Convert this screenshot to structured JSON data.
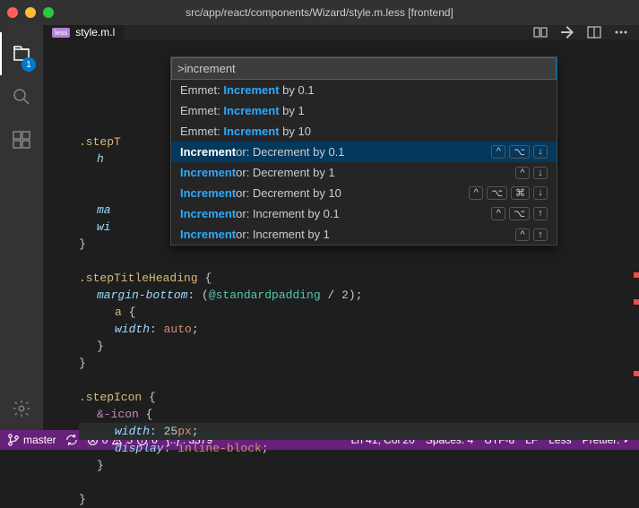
{
  "window": {
    "title": "src/app/react/components/Wizard/style.m.less [frontend]"
  },
  "tab": {
    "lang": "less",
    "name": "style.m.l"
  },
  "explorer_badge": "1",
  "command_palette": {
    "query": ">increment",
    "items": [
      {
        "prefix": "Emmet: ",
        "bold": "Increment",
        "suffix": " by 0.1",
        "keys": []
      },
      {
        "prefix": "Emmet: ",
        "bold": "Increment",
        "suffix": " by 1",
        "keys": []
      },
      {
        "prefix": "Emmet: ",
        "bold": "Increment",
        "suffix": " by 10",
        "keys": []
      },
      {
        "prefix": "",
        "bold": "Increment",
        "suffix": "or: Decrement by 0.1",
        "keys": [
          "^",
          "⌥",
          "↓"
        ],
        "selected": true
      },
      {
        "prefix": "",
        "bold": "Increment",
        "suffix": "or: Decrement by 1",
        "keys": [
          "^",
          "↓"
        ]
      },
      {
        "prefix": "",
        "bold": "Increment",
        "suffix": "or: Decrement by 10",
        "keys": [
          "^",
          "⌥",
          "⌘",
          "↓"
        ]
      },
      {
        "prefix": "",
        "bold": "Increment",
        "suffix": "or: Increment by 0.1",
        "keys": [
          "^",
          "⌥",
          "↑"
        ]
      },
      {
        "prefix": "",
        "bold": "Increment",
        "suffix": "or: Increment by 1",
        "keys": [
          "^",
          "↑"
        ]
      }
    ]
  },
  "code": {
    "lines": [
      {
        "t": "sel-open",
        "text": ".stepT"
      },
      {
        "t": "prop-frag",
        "text": "h"
      },
      {
        "t": "blank"
      },
      {
        "t": "blank"
      },
      {
        "t": "prop-frag",
        "text": "ma"
      },
      {
        "t": "prop-frag",
        "text": "wi"
      },
      {
        "t": "close"
      },
      {
        "t": "blank"
      },
      {
        "t": "sel-open-full",
        "sel": ".stepTitleHeading"
      },
      {
        "t": "decl-var",
        "prop": "margin-bottom",
        "var": "@standardpadding",
        "op": "/",
        "num": "2"
      },
      {
        "t": "sel-open-nested",
        "sel": "a"
      },
      {
        "t": "decl-kw",
        "prop": "width",
        "val": "auto"
      },
      {
        "t": "close-nested"
      },
      {
        "t": "close"
      },
      {
        "t": "blank"
      },
      {
        "t": "sel-open-full",
        "sel": ".stepIcon"
      },
      {
        "t": "amp-open",
        "sel": "&-icon"
      },
      {
        "t": "decl-unit",
        "prop": "width",
        "num": "25",
        "unit": "px",
        "hl": true
      },
      {
        "t": "decl-kw",
        "prop": "display",
        "val": "inline-block"
      },
      {
        "t": "close-nested"
      },
      {
        "t": "blank"
      },
      {
        "t": "close"
      }
    ]
  },
  "status": {
    "branch": "master",
    "errors": "0",
    "warnings": "5",
    "info": "0",
    "braces": "{..} : 3379",
    "cursor": "Ln 41, Col 20",
    "spaces": "Spaces: 4",
    "encoding": "UTF-8",
    "eol": "LF",
    "lang": "Less",
    "prettier": "Prettier: ✓"
  }
}
